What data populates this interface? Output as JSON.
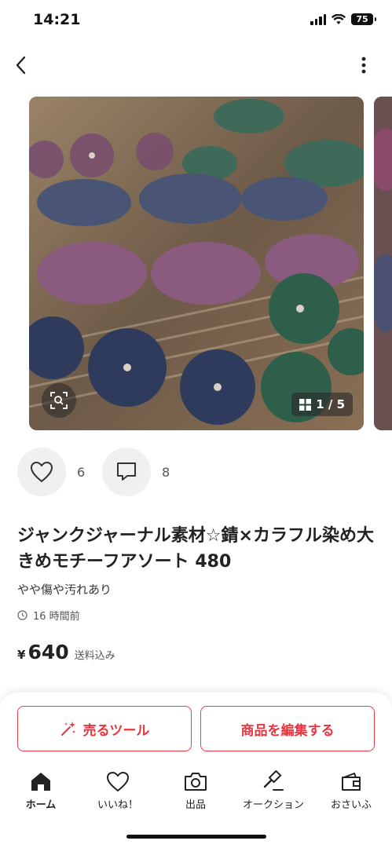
{
  "status_bar": {
    "time": "14:21",
    "battery": "75"
  },
  "nav": {
    "back_icon": "chevron-left-icon",
    "more_icon": "vertical-dots-icon"
  },
  "gallery": {
    "page_indicator": "1 / 5",
    "zoom_icon": "image-search-icon",
    "grid_icon": "grid-icon"
  },
  "actions": {
    "like_count": "6",
    "comment_count": "8"
  },
  "item": {
    "title": "ジャンクジャーナル素材☆錆×カラフル染め大きめモチーフアソート 480",
    "condition": "やや傷や汚れあり",
    "posted": "16 時間前",
    "currency": "¥",
    "price": "640",
    "shipping": "送料込み"
  },
  "buttons": {
    "sell_tool": "売るツール",
    "edit_item": "商品を編集する"
  },
  "tabs": [
    {
      "label": "ホーム",
      "icon": "home-icon"
    },
    {
      "label": "いいね！",
      "icon": "heart-icon"
    },
    {
      "label": "出品",
      "icon": "camera-icon"
    },
    {
      "label": "オークション",
      "icon": "gavel-icon"
    },
    {
      "label": "おさいふ",
      "icon": "wallet-icon"
    }
  ],
  "colors": {
    "accent": "#e8363f",
    "text": "#222222"
  }
}
